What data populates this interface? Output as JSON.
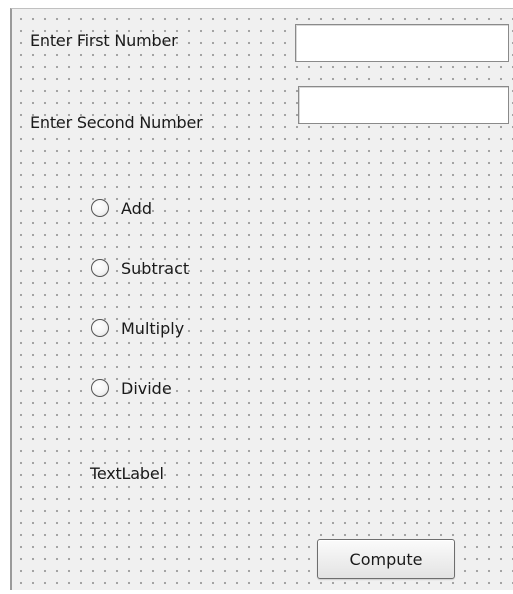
{
  "form": {
    "first_number_label": "Enter First Number",
    "first_number_value": "",
    "second_number_label": "Enter Second Number",
    "second_number_value": "",
    "operations": [
      {
        "label": "Add",
        "checked": false
      },
      {
        "label": "Subtract",
        "checked": false
      },
      {
        "label": "Multiply",
        "checked": false
      },
      {
        "label": "Divide",
        "checked": false
      }
    ],
    "result_label": "TextLabel",
    "compute_button_label": "Compute"
  },
  "colors": {
    "canvas_background": "#f0f0f0",
    "grid_dot": "#9c9c9c",
    "input_background": "#ffffff"
  }
}
